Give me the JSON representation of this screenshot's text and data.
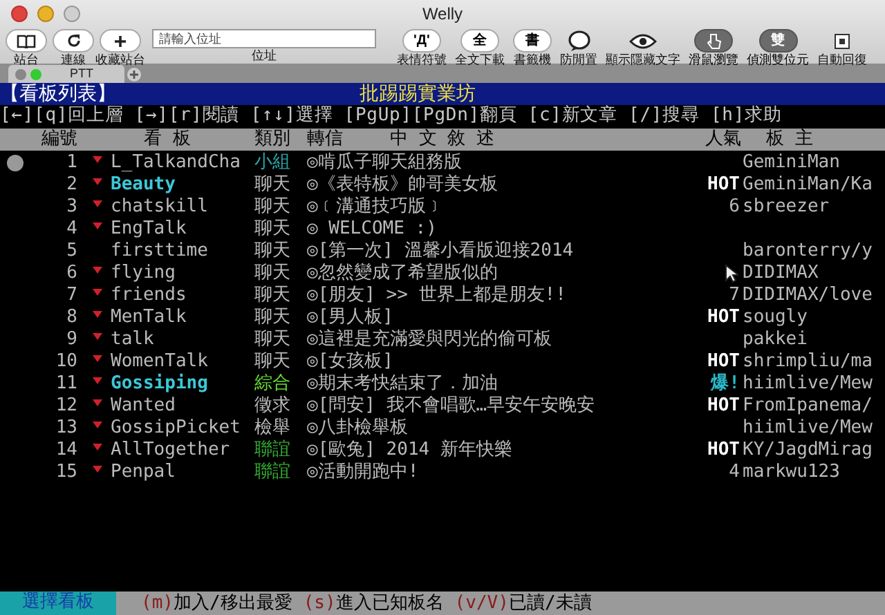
{
  "window": {
    "title": "Welly"
  },
  "toolbar": {
    "left": [
      {
        "kind": "book",
        "label": "站台"
      },
      {
        "kind": "refresh",
        "label": "連線"
      },
      {
        "kind": "plus",
        "label": "收藏站台"
      }
    ],
    "address": {
      "placeholder": "請輸入位址",
      "label": "位址"
    },
    "right": [
      {
        "kind": "glyph",
        "glyph": "'Д'",
        "label": "表情符號",
        "on": false
      },
      {
        "kind": "glyph",
        "glyph": "全",
        "label": "全文下載",
        "on": false
      },
      {
        "kind": "glyph",
        "glyph": "書",
        "label": "書籤機",
        "on": false
      },
      {
        "kind": "bubble",
        "label": "防閒置",
        "on": false
      },
      {
        "kind": "eye",
        "label": "顯示隱藏文字",
        "on": false
      },
      {
        "kind": "hand",
        "label": "滑鼠瀏覽",
        "on": true
      },
      {
        "kind": "glyph",
        "glyph": "雙",
        "label": "偵測雙位元",
        "on": true
      },
      {
        "kind": "square",
        "label": "自動回復",
        "on": false
      }
    ]
  },
  "tabs": [
    {
      "label": "PTT",
      "selected": true
    }
  ],
  "terminal": {
    "header": {
      "left": "【看板列表】",
      "title": "批踢踢實業坊"
    },
    "help": "[←][q]回上層 [→][r]閱讀 [↑↓]選擇 [PgUp][PgDn]翻頁 [c]新文章 [/]搜尋 [h]求助",
    "columns": [
      "編號",
      "看 板",
      "類別",
      "轉信",
      "中 文 敘 述",
      "人氣",
      "板 主"
    ],
    "rows": [
      {
        "number": "1",
        "favorite": true,
        "name": "L_TalkandCha",
        "highlighted": false,
        "category": {
          "text": "小組",
          "color": "#2aa6a6"
        },
        "description": "◎啃瓜子聊天組務版",
        "moderator": "GeminiMan",
        "selected": true
      },
      {
        "number": "2",
        "favorite": true,
        "name": "Beauty",
        "highlighted": true,
        "category": {
          "text": "聊天",
          "color": "#bbbbbb"
        },
        "description": "◎《表特板》帥哥美女板",
        "popularity": {
          "text": "HOT",
          "kind": "hot"
        },
        "moderator": "GeminiMan/Ka",
        "selected": false
      },
      {
        "number": "3",
        "favorite": true,
        "name": "chatskill",
        "highlighted": false,
        "category": {
          "text": "聊天",
          "color": "#bbbbbb"
        },
        "description": "◎﹝溝通技巧版﹞",
        "popularity": {
          "text": "6",
          "kind": "count"
        },
        "moderator": "sbreezer",
        "selected": false
      },
      {
        "number": "4",
        "favorite": true,
        "name": "EngTalk",
        "highlighted": false,
        "category": {
          "text": "聊天",
          "color": "#bbbbbb"
        },
        "description": "◎ WELCOME :)",
        "selected": false
      },
      {
        "number": "5",
        "favorite": false,
        "name": "firsttime",
        "highlighted": false,
        "category": {
          "text": "聊天",
          "color": "#bbbbbb"
        },
        "description": "◎[第一次] 溫馨小看版迎接2014",
        "moderator": "baronterry/y",
        "selected": false
      },
      {
        "number": "6",
        "favorite": true,
        "name": "flying",
        "highlighted": false,
        "category": {
          "text": "聊天",
          "color": "#bbbbbb"
        },
        "description": "◎忽然變成了希望版似的",
        "moderator": "DIDIMAX",
        "selected": false
      },
      {
        "number": "7",
        "favorite": true,
        "name": "friends",
        "highlighted": false,
        "category": {
          "text": "聊天",
          "color": "#bbbbbb"
        },
        "description": "◎[朋友] >> 世界上都是朋友!!",
        "popularity": {
          "text": "7",
          "kind": "count"
        },
        "moderator": "DIDIMAX/love",
        "selected": false
      },
      {
        "number": "8",
        "favorite": true,
        "name": "MenTalk",
        "highlighted": false,
        "category": {
          "text": "聊天",
          "color": "#bbbbbb"
        },
        "description": "◎[男人板]",
        "popularity": {
          "text": "HOT",
          "kind": "hot"
        },
        "moderator": "sougly",
        "selected": false
      },
      {
        "number": "9",
        "favorite": true,
        "name": "talk",
        "highlighted": false,
        "category": {
          "text": "聊天",
          "color": "#bbbbbb"
        },
        "description": "◎這裡是充滿愛與閃光的偷可板",
        "moderator": "pakkei",
        "selected": false
      },
      {
        "number": "10",
        "favorite": true,
        "name": "WomenTalk",
        "highlighted": false,
        "category": {
          "text": "聊天",
          "color": "#bbbbbb"
        },
        "description": "◎[女孩板]",
        "popularity": {
          "text": "HOT",
          "kind": "hot"
        },
        "moderator": "shrimpliu/ma",
        "selected": false
      },
      {
        "number": "11",
        "favorite": true,
        "name": "Gossiping",
        "highlighted": true,
        "category": {
          "text": "綜合",
          "color": "#66dd33"
        },
        "description": "◎期末考快結束了．加油",
        "popularity": {
          "text": "爆!",
          "kind": "burst"
        },
        "moderator": "hiimlive/Mew",
        "selected": false
      },
      {
        "number": "12",
        "favorite": true,
        "name": "Wanted",
        "highlighted": false,
        "category": {
          "text": "徵求",
          "color": "#bbbbbb"
        },
        "description": "◎[問安] 我不會唱歌…早安午安晚安",
        "popularity": {
          "text": "HOT",
          "kind": "hot"
        },
        "moderator": "FromIpanema/",
        "selected": false
      },
      {
        "number": "13",
        "favorite": true,
        "name": "GossipPicket",
        "highlighted": false,
        "category": {
          "text": "檢舉",
          "color": "#bbbbbb"
        },
        "description": "◎八卦檢舉板",
        "moderator": "hiimlive/Mew",
        "selected": false
      },
      {
        "number": "14",
        "favorite": true,
        "name": "AllTogether",
        "highlighted": false,
        "category": {
          "text": "聯誼",
          "color": "#33aa33"
        },
        "description": "◎[歐兔] 2014 新年快樂",
        "popularity": {
          "text": "HOT",
          "kind": "hot"
        },
        "moderator": "KY/JagdMirag",
        "selected": false
      },
      {
        "number": "15",
        "favorite": true,
        "name": "Penpal",
        "highlighted": false,
        "category": {
          "text": "聯誼",
          "color": "#33aa33"
        },
        "description": "◎活動開跑中!",
        "popularity": {
          "text": "4",
          "kind": "count"
        },
        "moderator": "markwu123",
        "selected": false
      }
    ],
    "status_bar": {
      "mode": "選擇看板",
      "hints": [
        {
          "key": "(m)",
          "label": "加入/移出最愛"
        },
        {
          "key": "(s)",
          "label": "進入已知板名"
        },
        {
          "key": "(v/V)",
          "label": "已讀/未讀"
        }
      ]
    }
  }
}
